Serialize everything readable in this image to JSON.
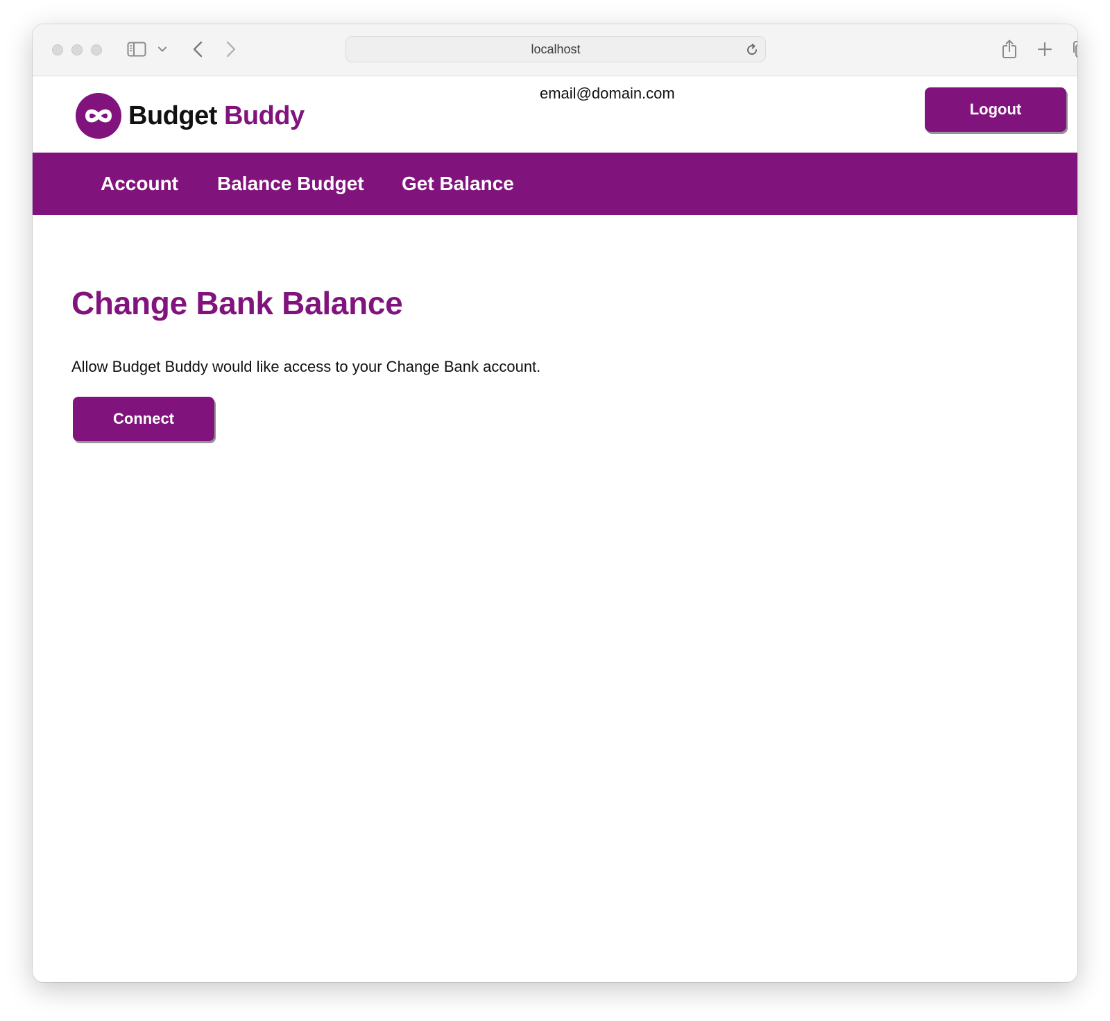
{
  "browser": {
    "url": "localhost",
    "icons": {
      "sidebar": "sidebar-icon",
      "sidebar_menu": "chevron-down-icon",
      "back": "chevron-left-icon",
      "forward": "chevron-right-icon",
      "reload": "reload-icon",
      "share": "share-icon",
      "new_tab": "plus-icon",
      "tab_overview": "tabs-icon"
    }
  },
  "header": {
    "brand_first": "Budget",
    "brand_second": "Buddy",
    "user_email": "email@domain.com",
    "logout_label": "Logout",
    "logo_icon": "infinity-logo-icon"
  },
  "nav": {
    "items": [
      {
        "label": "Account"
      },
      {
        "label": "Balance Budget"
      },
      {
        "label": "Get Balance"
      }
    ]
  },
  "main": {
    "title": "Change Bank Balance",
    "description": "Allow Budget Buddy would like access to your Change Bank account.",
    "connect_label": "Connect"
  },
  "colors": {
    "brand": "#81147c",
    "text": "#111111",
    "chrome": "#f5f4f4"
  }
}
